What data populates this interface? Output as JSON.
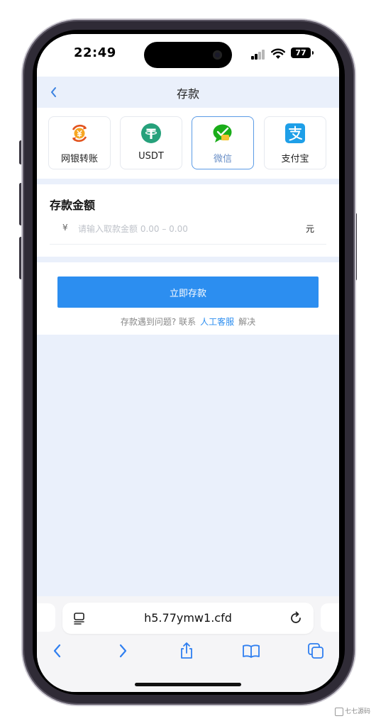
{
  "status_bar": {
    "time": "22:49",
    "battery": "77"
  },
  "nav": {
    "title": "存款"
  },
  "payment_tabs": [
    {
      "label": "网银转账",
      "icon": "bank-transfer-icon"
    },
    {
      "label": "USDT",
      "icon": "tether-icon"
    },
    {
      "label": "微信",
      "icon": "wechat-pay-icon",
      "active": true
    },
    {
      "label": "支付宝",
      "icon": "alipay-icon"
    }
  ],
  "amount": {
    "title": "存款金额",
    "currency": "¥",
    "placeholder": "请输入取款金额 0.00 – 0.00",
    "value": "",
    "unit": "元"
  },
  "action": {
    "button_label": "立即存款",
    "help_prefix": "存款遇到问题? 联系",
    "help_link": "人工客服",
    "help_suffix": "解决"
  },
  "safari": {
    "url": "h5.77ymw1.cfd"
  },
  "watermark": "七七源码",
  "colors": {
    "accent": "#2c8ef0",
    "page_bg": "#eaf0fb",
    "active_tab_border": "#5b9be6"
  }
}
